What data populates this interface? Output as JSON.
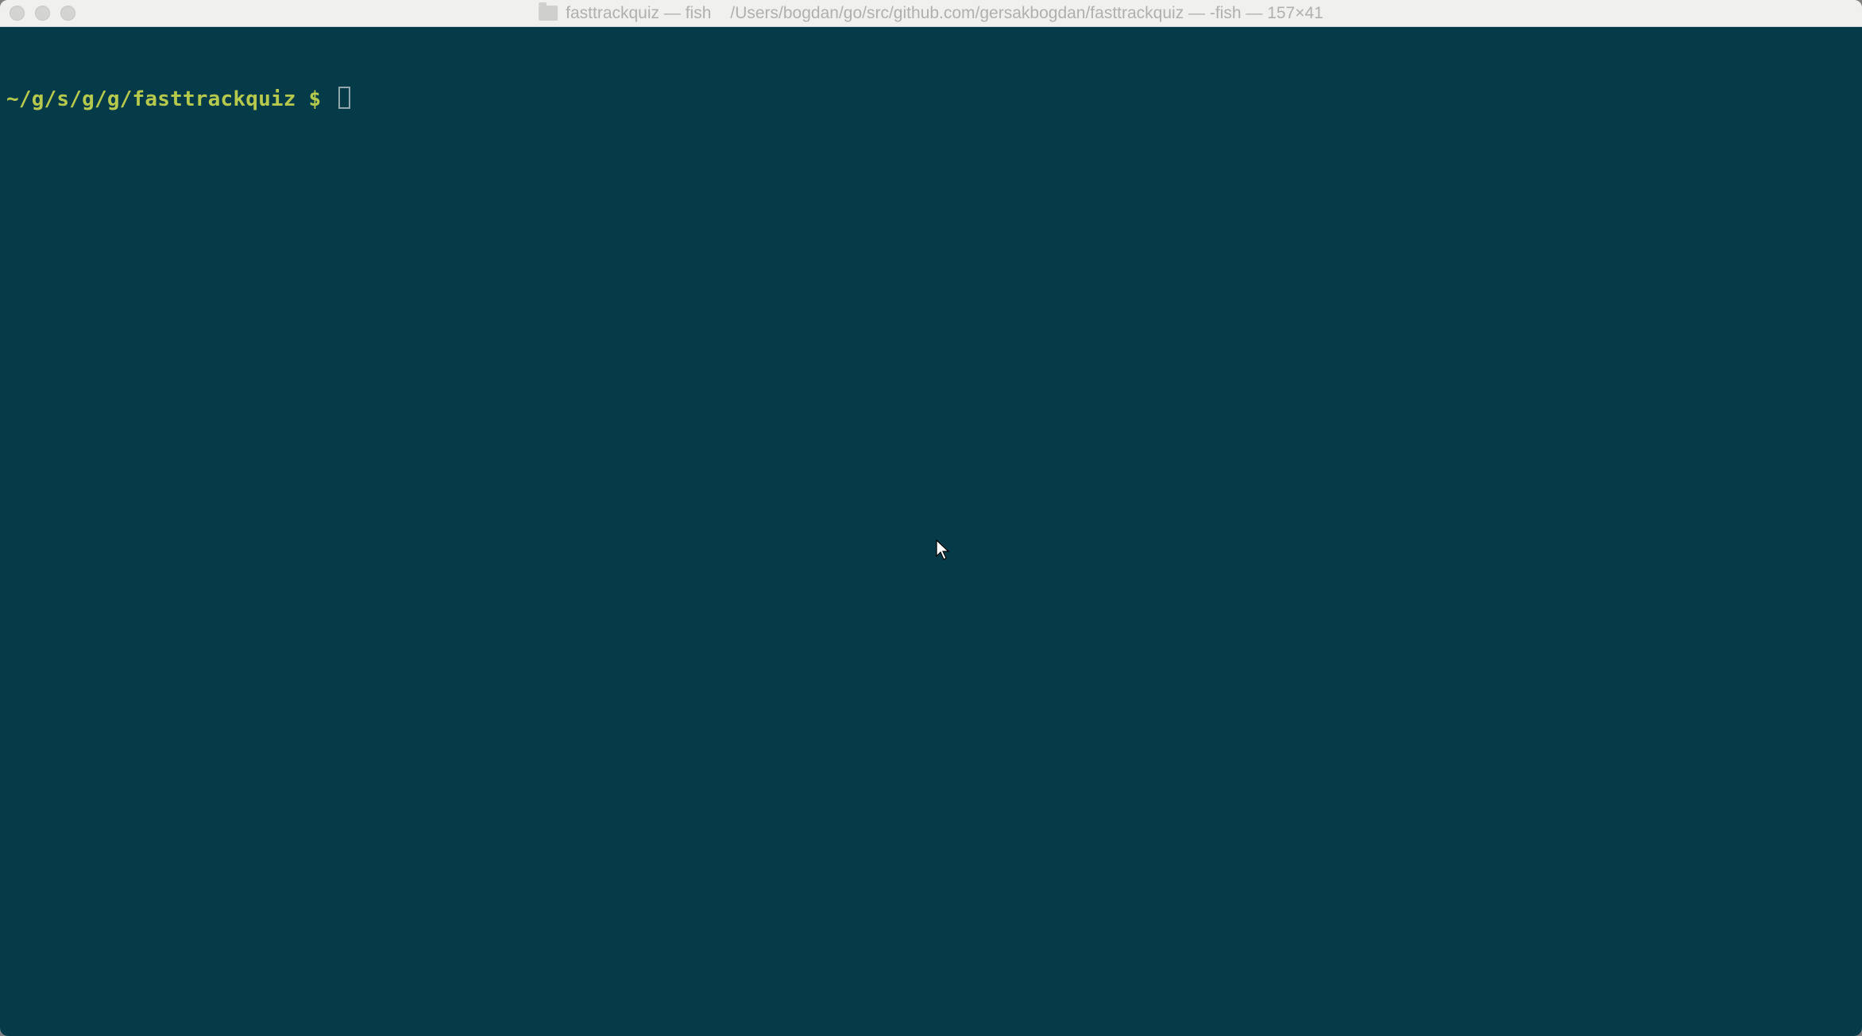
{
  "titlebar": {
    "app_title": "fasttrackquiz — fish",
    "path_title": "/Users/bogdan/go/src/github.com/gersakbogdan/fasttrackquiz — -fish — 157×41"
  },
  "terminal": {
    "prompt_path": "~/g/s/g/g/fasttrackquiz",
    "prompt_symbol": " $ "
  }
}
